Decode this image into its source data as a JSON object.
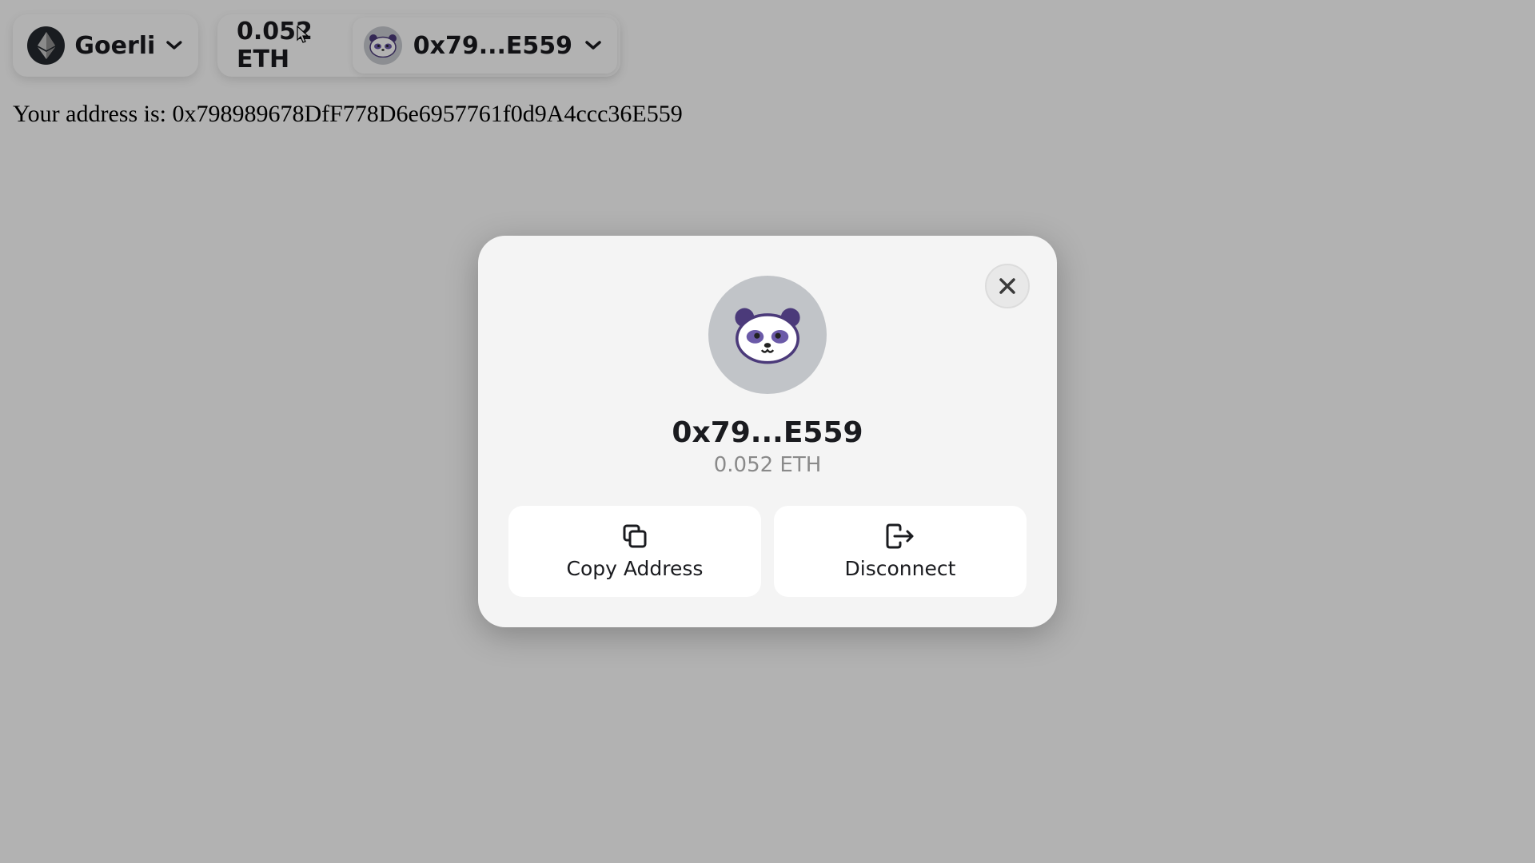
{
  "header": {
    "network_name": "Goerli",
    "balance": "0.052 ETH",
    "account_short": "0x79...E559"
  },
  "page": {
    "address_text": "Your address is: 0x798989678DfF778D6e6957761f0d9A4ccc36E559"
  },
  "modal": {
    "address": "0x79...E559",
    "balance": "0.052 ETH",
    "copy_label": "Copy Address",
    "disconnect_label": "Disconnect"
  },
  "icons": {
    "network": "ethereum-icon",
    "avatar": "panda-icon",
    "close": "close-icon",
    "copy": "copy-icon",
    "disconnect": "disconnect-icon",
    "chevron": "chevron-down-icon"
  },
  "colors": {
    "overlay": "rgba(0,0,0,0.30)",
    "modal_bg": "#f4f4f4",
    "text_primary": "#1a1b1f",
    "text_secondary": "#8a8a8a",
    "avatar_bg": "#c1c4c8",
    "panda_accent": "#4b3a7a"
  }
}
